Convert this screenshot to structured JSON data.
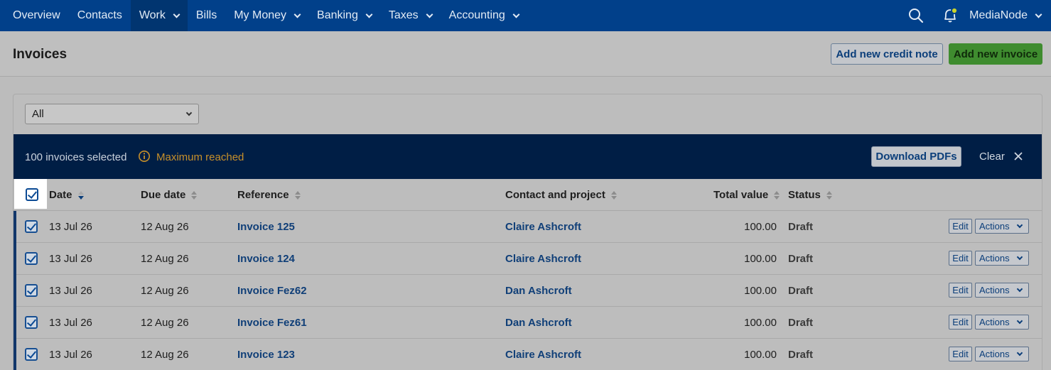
{
  "nav": {
    "items": [
      {
        "label": "Overview",
        "dropdown": false,
        "active": false
      },
      {
        "label": "Contacts",
        "dropdown": false,
        "active": false
      },
      {
        "label": "Work",
        "dropdown": true,
        "active": true
      },
      {
        "label": "Bills",
        "dropdown": false,
        "active": false
      },
      {
        "label": "My Money",
        "dropdown": true,
        "active": false
      },
      {
        "label": "Banking",
        "dropdown": true,
        "active": false
      },
      {
        "label": "Taxes",
        "dropdown": true,
        "active": false
      },
      {
        "label": "Accounting",
        "dropdown": true,
        "active": false
      }
    ],
    "account_label": "MediaNode",
    "icons": {
      "search": "search-icon",
      "bell": "bell-icon"
    }
  },
  "header": {
    "title": "Invoices",
    "add_credit_note": "Add new credit note",
    "add_invoice": "Add new invoice"
  },
  "filter": {
    "selected": "All"
  },
  "selection_bar": {
    "count_text": "100 invoices selected",
    "warning_text": "Maximum reached",
    "download_label": "Download PDFs",
    "clear_label": "Clear"
  },
  "table": {
    "columns": {
      "date": "Date",
      "due_date": "Due date",
      "reference": "Reference",
      "contact": "Contact and project",
      "total": "Total value",
      "status": "Status"
    },
    "edit_label": "Edit",
    "actions_label": "Actions",
    "rows": [
      {
        "date": "13 Jul 26",
        "due": "12 Aug 26",
        "reference": "Invoice 125",
        "contact": "Claire Ashcroft",
        "total": "100.00",
        "status": "Draft"
      },
      {
        "date": "13 Jul 26",
        "due": "12 Aug 26",
        "reference": "Invoice 124",
        "contact": "Claire Ashcroft",
        "total": "100.00",
        "status": "Draft"
      },
      {
        "date": "13 Jul 26",
        "due": "12 Aug 26",
        "reference": "Invoice Fez62",
        "contact": "Dan Ashcroft",
        "total": "100.00",
        "status": "Draft"
      },
      {
        "date": "13 Jul 26",
        "due": "12 Aug 26",
        "reference": "Invoice Fez61",
        "contact": "Dan Ashcroft",
        "total": "100.00",
        "status": "Draft"
      },
      {
        "date": "13 Jul 26",
        "due": "12 Aug 26",
        "reference": "Invoice 123",
        "contact": "Claire Ashcroft",
        "total": "100.00",
        "status": "Draft"
      }
    ]
  },
  "colors": {
    "nav_bg": "#01408a",
    "selection_bar_bg": "#001e45",
    "primary_button": "#3f8c2f",
    "warning": "#c7902a",
    "link": "#103f78"
  }
}
